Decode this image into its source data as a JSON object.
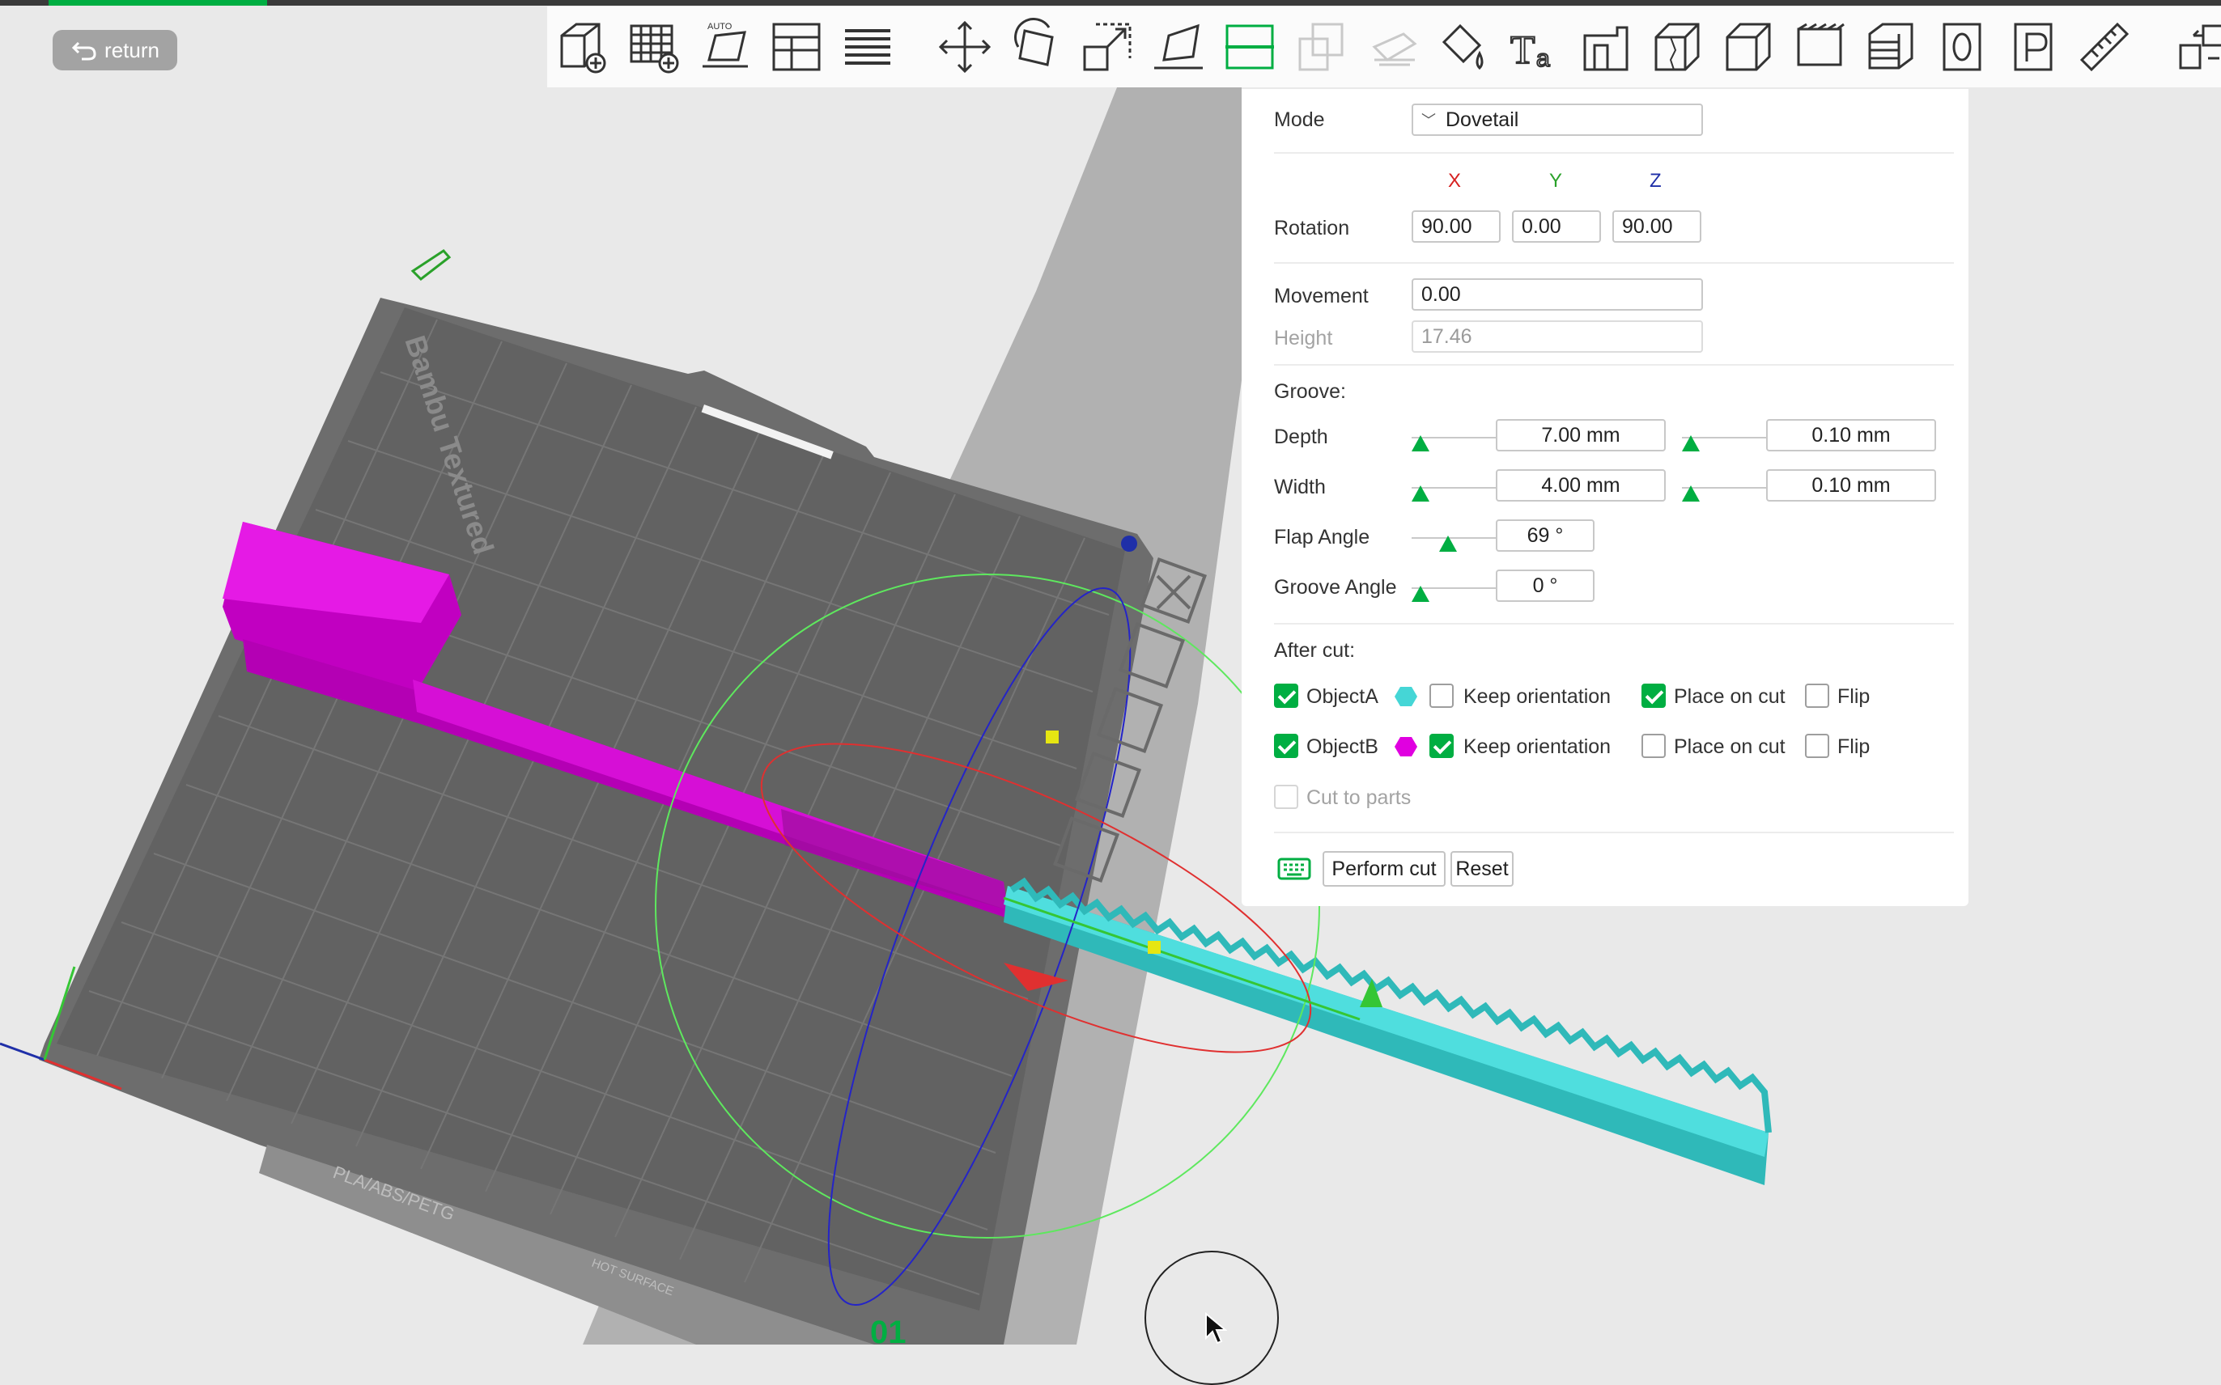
{
  "top": {
    "return_label": "return"
  },
  "toolbar": {
    "icons": [
      "add-object-icon",
      "arrange-grid-icon",
      "auto-orient-icon",
      "arrange-icon",
      "layers-icon",
      "move-icon",
      "rotate-icon",
      "scale-icon",
      "lay-on-face-icon",
      "cut-icon",
      "mesh-boolean-icon",
      "support-paint-icon",
      "color-paint-icon",
      "text-icon",
      "emboss-icon",
      "seam-icon",
      "assembly-icon",
      "fuzzy-skin-icon",
      "variable-layer-icon",
      "object-list-icon",
      "plate-list-icon",
      "measure-icon",
      "split-icon"
    ]
  },
  "bed": {
    "brand_text": "Bambu Textured",
    "material_text": "PLA/ABS/PETG",
    "hot_surface_text": "HOT SURFACE",
    "plate_number": "01",
    "side_icons": [
      "close-icon",
      "auto-orient-icon",
      "arrange-icon",
      "lock-icon",
      "settings-icon"
    ]
  },
  "panel": {
    "mode_label": "Mode",
    "mode_value": "Dovetail",
    "axis_x": "X",
    "axis_y": "Y",
    "axis_z": "Z",
    "rotation_label": "Rotation",
    "rotation_x": "90.00",
    "rotation_y": "0.00",
    "rotation_z": "90.00",
    "movement_label": "Movement",
    "movement_value": "0.00",
    "height_label": "Height",
    "height_value": "17.46",
    "groove_label": "Groove:",
    "depth_label": "Depth",
    "depth_value": "7.00  mm",
    "depth_tol": "0.10  mm",
    "width_label": "Width",
    "width_value": "4.00  mm",
    "width_tol": "0.10  mm",
    "flap_label": "Flap Angle",
    "flap_value": "69 °",
    "groove_angle_label": "Groove Angle",
    "groove_angle_value": "0 °",
    "after_cut_label": "After cut:",
    "objA": {
      "label": "ObjectA",
      "keep": "Keep orientation",
      "place": "Place on cut",
      "flip": "Flip"
    },
    "objB": {
      "label": "ObjectB",
      "keep": "Keep orientation",
      "place": "Place on cut",
      "flip": "Flip"
    },
    "cut_parts_label": "Cut to parts",
    "perform_label": "Perform cut",
    "reset_label": "Reset"
  },
  "colors": {
    "accent": "#00ae42",
    "objectA": "#45d6d6",
    "objectB": "#e000e0",
    "axis_x": "#d62020",
    "axis_y": "#2aa12a",
    "axis_z": "#1f2fa8"
  }
}
